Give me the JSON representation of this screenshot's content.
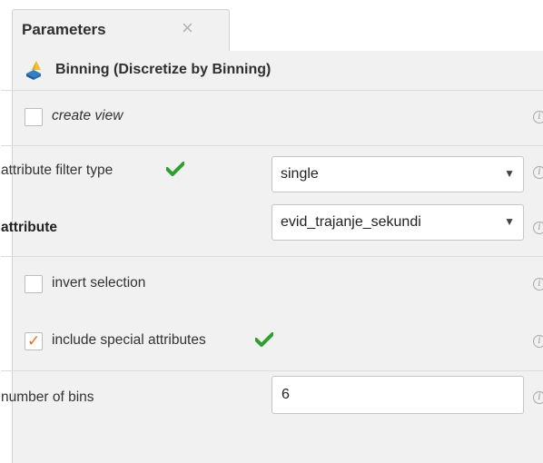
{
  "tab": {
    "title": "Parameters",
    "close_glyph": "×",
    "close_icon": "close-icon"
  },
  "operator": {
    "title": "Binning (Discretize by Binning)",
    "icon": "binning-operator-icon"
  },
  "params": {
    "create_view": {
      "label": "create view",
      "checked": false
    },
    "attribute_filter_type": {
      "label": "attribute filter type",
      "value": "single",
      "arrow": "▼"
    },
    "attribute": {
      "label": "attribute",
      "value": "evid_trajanje_sekundi",
      "arrow": "▼"
    },
    "invert_selection": {
      "label": "invert selection",
      "checked": false
    },
    "include_special_attributes": {
      "label": "include special attributes",
      "checked": true,
      "checkmark": "✓"
    },
    "number_of_bins": {
      "label": "number of bins",
      "value": "6"
    }
  },
  "info_glyph": "i",
  "colors": {
    "panel_bg": "#f1f1f1",
    "green_check": "#2ca02c",
    "orange_check": "#ef6b28"
  }
}
